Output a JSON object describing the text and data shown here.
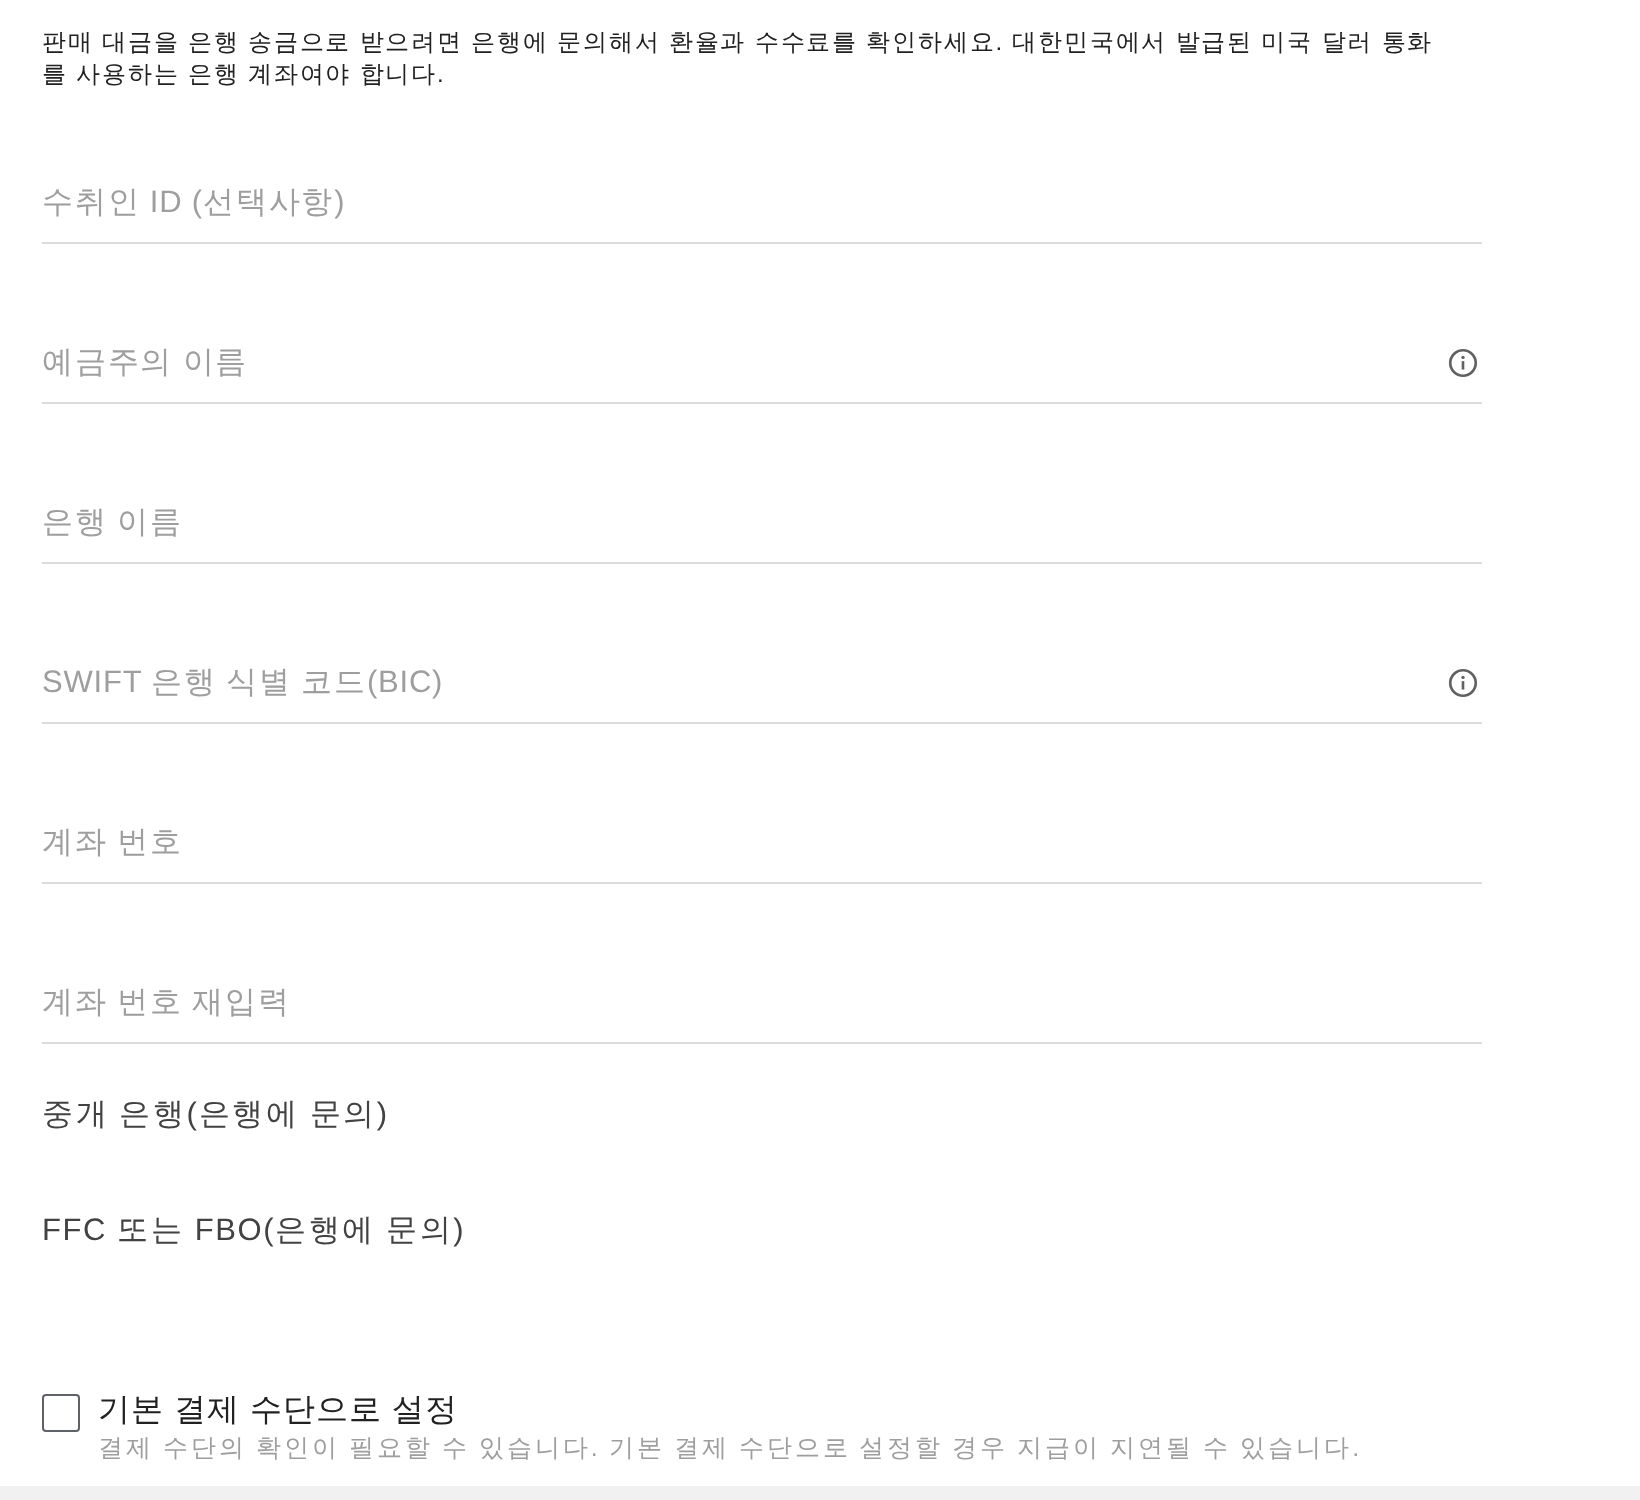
{
  "intro": "판매 대금을 은행 송금으로 받으려면 은행에 문의해서 환율과 수수료를 확인하세요. 대한민국에서 발급된 미국 달러 통화를 사용하는 은행 계좌여야 합니다.",
  "fields": [
    {
      "placeholder": "수취인 ID (선택사항)",
      "info": false
    },
    {
      "placeholder": "예금주의 이름",
      "info": true
    },
    {
      "placeholder": "은행 이름",
      "info": false
    },
    {
      "placeholder": "SWIFT 은행 식별 코드(BIC)",
      "info": true
    },
    {
      "placeholder": "계좌 번호",
      "info": false
    },
    {
      "placeholder": "계좌 번호 재입력",
      "info": false
    }
  ],
  "sections": [
    {
      "label": "중개 은행(은행에 문의)"
    },
    {
      "label": "FFC 또는 FBO(은행에 문의)"
    }
  ],
  "default_payment": {
    "label": "기본 결제 수단으로 설정",
    "checked": false,
    "note": "결제 수단의 확인이 필요할 수 있습니다. 기본 결제 수단으로 설정할 경우 지급이 지연될 수 있습니다."
  }
}
